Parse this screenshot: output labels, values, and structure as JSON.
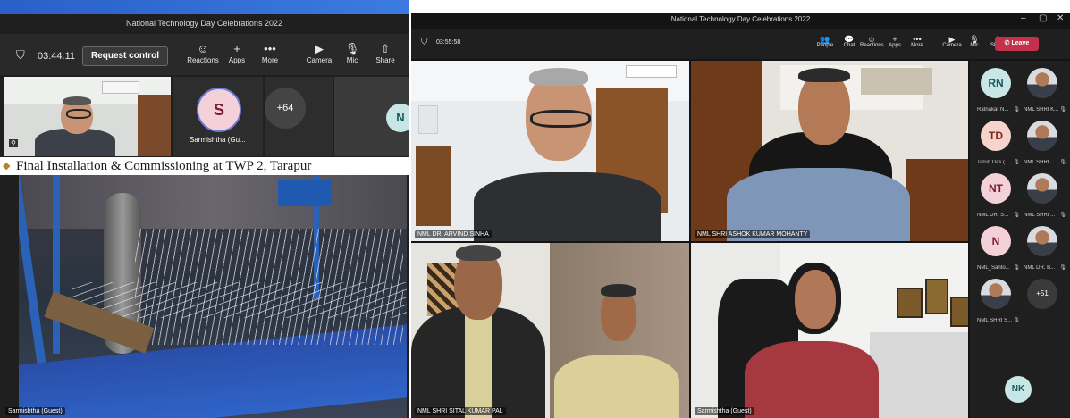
{
  "left_window": {
    "title": "National Technology Day Celebrations 2022",
    "timer": "03:44:11",
    "request_control_label": "Request control",
    "toolbar": [
      {
        "label": "Reactions",
        "icon": "reactions-icon",
        "glyph": "☺"
      },
      {
        "label": "Apps",
        "icon": "apps-icon",
        "glyph": "+"
      },
      {
        "label": "More",
        "icon": "more-icon",
        "glyph": "•••"
      },
      {
        "label": "Camera",
        "icon": "camera-icon",
        "glyph": "▶"
      },
      {
        "label": "Mic",
        "icon": "mic-icon",
        "glyph": "🎙"
      },
      {
        "label": "Share",
        "icon": "share-icon",
        "glyph": "⇧"
      }
    ],
    "participant_initials": "S",
    "participant_name": "Sarmishtha (Gu...",
    "overflow_count": "+64",
    "partial_initials": "N",
    "caption": "Final Installation & Commissioning at TWP 2, Tarapur",
    "presenter_tag": "Sarmishtha (Guest)"
  },
  "right_window": {
    "title": "National Technology Day Celebrations 2022",
    "timer": "03:55:58",
    "toolbar": [
      {
        "label": "People",
        "icon": "people-icon",
        "glyph": "👥"
      },
      {
        "label": "Chat",
        "icon": "chat-icon",
        "glyph": "💬"
      },
      {
        "label": "Reactions",
        "icon": "reactions-icon",
        "glyph": "☺"
      },
      {
        "label": "Apps",
        "icon": "apps-icon",
        "glyph": "+"
      },
      {
        "label": "More",
        "icon": "more-icon",
        "glyph": "•••"
      },
      {
        "label": "Camera",
        "icon": "camera-icon",
        "glyph": "▶"
      },
      {
        "label": "Mic",
        "icon": "mic-icon",
        "glyph": "🎙"
      },
      {
        "label": "Share",
        "icon": "share-icon",
        "glyph": "⇧"
      }
    ],
    "leave_label": "Leave",
    "tiles": [
      {
        "name": "NML DR. ARVIND SINHA"
      },
      {
        "name": "NML SHRI ASHOK KUMAR MOHANTY"
      },
      {
        "name": "NML SHRI SITAL KUMAR PAL"
      },
      {
        "name": "Sarmishtha (Guest)"
      }
    ],
    "sidebar": [
      {
        "initials": "RN",
        "name": "Ratnakar N...",
        "bg": "#c9e6e6",
        "fg": "#1b5a5a"
      },
      {
        "photo": true,
        "name": "NML SHRI K..."
      },
      {
        "initials": "TD",
        "name": "Tarun Das (...",
        "bg": "#f6d4cc",
        "fg": "#7a2a1a"
      },
      {
        "photo": true,
        "name": "NML SHRI ..."
      },
      {
        "initials": "NT",
        "name": "NML DR. S...",
        "bg": "#f4d1d8",
        "fg": "#7a1a2a"
      },
      {
        "photo": true,
        "name": "NML SHRI ..."
      },
      {
        "initials": "N",
        "name": "NML_Santo...",
        "bg": "#f4d1d8",
        "fg": "#7a1a2a"
      },
      {
        "photo": true,
        "name": "NML DR. B..."
      },
      {
        "photo": true,
        "name": "NML SHRI S..."
      },
      {
        "overflow": "+51"
      }
    ],
    "bottom_initials": "NK"
  },
  "colors": {
    "leave": "#c4314b",
    "teams_dark": "#292929",
    "accent_blue": "#3b7be0"
  }
}
